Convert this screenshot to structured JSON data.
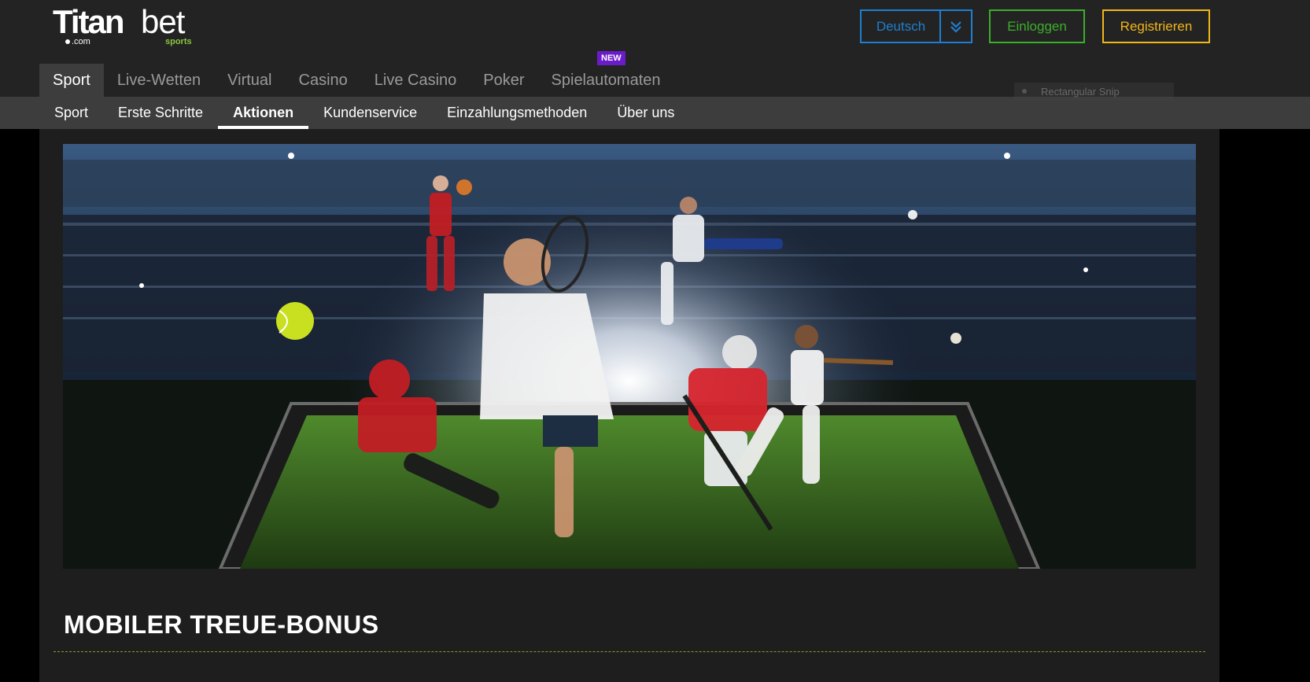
{
  "logo": {
    "brand_bold": "Titan",
    "brand_light": "bet",
    "suffix": ".com",
    "tagline": "sports"
  },
  "header": {
    "language": "Deutsch",
    "login_label": "Einloggen",
    "register_label": "Registrieren"
  },
  "main_nav": {
    "items": [
      {
        "label": "Sport",
        "active": true
      },
      {
        "label": "Live-Wetten"
      },
      {
        "label": "Virtual"
      },
      {
        "label": "Casino"
      },
      {
        "label": "Live Casino"
      },
      {
        "label": "Poker"
      },
      {
        "label": "Spielautomaten"
      }
    ],
    "badge": "NEW"
  },
  "sub_nav": {
    "items": [
      {
        "label": "Sport"
      },
      {
        "label": "Erste Schritte"
      },
      {
        "label": "Aktionen",
        "active": true
      },
      {
        "label": "Kundenservice"
      },
      {
        "label": "Einzahlungsmethoden"
      },
      {
        "label": "Über uns"
      }
    ]
  },
  "overlay": {
    "snip_label": "Rectangular Snip"
  },
  "page": {
    "heading": "MOBILER TREUE-BONUS"
  },
  "colors": {
    "header_bg": "#232323",
    "subnav_bg": "#3d3d3d",
    "language_blue": "#1e7fd0",
    "login_green": "#3cae2b",
    "register_yellow": "#f2b619",
    "badge_purple": "#6b1cc9",
    "rule_olive": "#8c9a2a"
  }
}
